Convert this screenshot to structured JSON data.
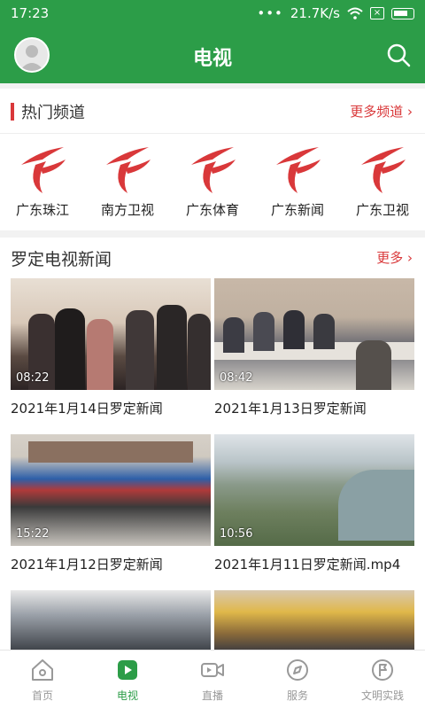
{
  "status": {
    "time": "17:23",
    "speed": "21.7K/s",
    "dots": "•••"
  },
  "header": {
    "title": "电视"
  },
  "hot": {
    "title": "热门频道",
    "more": "更多频道",
    "channels": [
      {
        "name": "广东珠江"
      },
      {
        "name": "南方卫视"
      },
      {
        "name": "广东体育"
      },
      {
        "name": "广东新闻"
      },
      {
        "name": "广东卫视"
      }
    ]
  },
  "news": {
    "title": "罗定电视新闻",
    "more": "更多",
    "items": [
      {
        "duration": "08:22",
        "title": "2021年1月14日罗定新闻"
      },
      {
        "duration": "08:42",
        "title": "2021年1月13日罗定新闻"
      },
      {
        "duration": "15:22",
        "title": "2021年1月12日罗定新闻"
      },
      {
        "duration": "10:56",
        "title": "2021年1月11日罗定新闻.mp4"
      }
    ]
  },
  "tabs": [
    {
      "label": "首页"
    },
    {
      "label": "电视"
    },
    {
      "label": "直播"
    },
    {
      "label": "服务"
    },
    {
      "label": "文明实践"
    }
  ],
  "colors": {
    "primary": "#2c9d48",
    "accent": "#d9383a"
  }
}
